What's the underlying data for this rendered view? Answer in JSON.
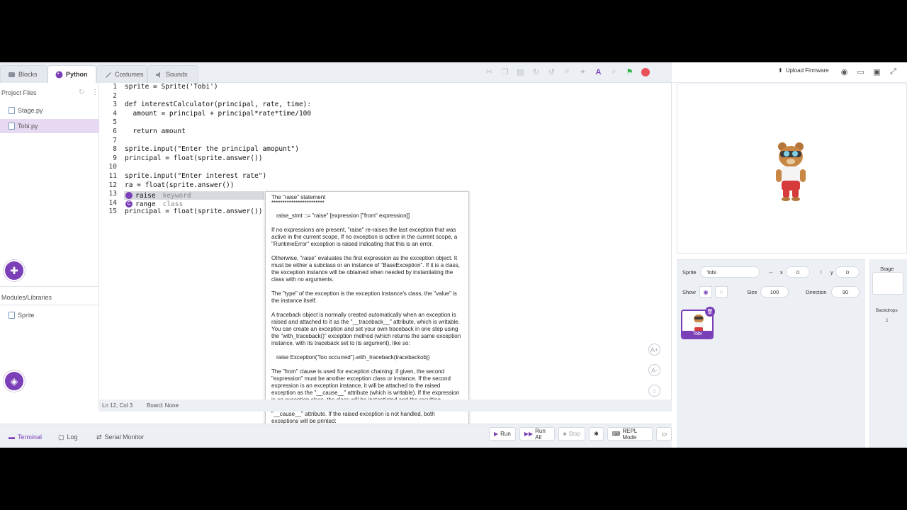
{
  "tabs": [
    {
      "label": "Blocks",
      "icon": "blocks-icon"
    },
    {
      "label": "Python",
      "icon": "python-icon"
    },
    {
      "label": "Costumes",
      "icon": "costumes-icon"
    },
    {
      "label": "Sounds",
      "icon": "sounds-icon"
    }
  ],
  "upload_firmware": "Upload Firmware",
  "sidebar": {
    "project_files_title": "Project Files",
    "files": [
      "Stage.py",
      "Tobi.py"
    ],
    "modules_title": "Modules/Libraries",
    "modules": [
      "Sprite"
    ]
  },
  "code_lines": [
    "sprite = Sprite('Tobi')",
    "",
    "def interestCalculator(principal, rate, time):",
    "  amount = principal + principal*rate*time/100",
    "",
    "  return amount",
    "",
    "sprite.input(\"Enter the principal amopunt\")",
    "principal = float(sprite.answer())",
    "",
    "sprite.input(\"Enter interest rate\")",
    "ra = float(sprite.answer())",
    "",
    "",
    "principal = float(sprite.answer())"
  ],
  "line_numbers": [
    "1",
    "2",
    "3",
    "4",
    "5",
    "6",
    "7",
    "8",
    "9",
    "10",
    "11",
    "12",
    "13",
    "14",
    "15"
  ],
  "autocomplete": [
    {
      "name": "raise",
      "kind": "keyword",
      "badge": ""
    },
    {
      "name": "range",
      "kind": "class",
      "badge": "C"
    }
  ],
  "doc": {
    "title": "The \"raise\" statement",
    "underline": "************************",
    "paragraphs": [
      "raise_stmt ::= \"raise\" [expression [\"from\" expression]]",
      "If no expressions are present, \"raise\" re-raises the last exception that was active in the current scope.  If no exception is active in the current scope, a \"RuntimeError\" exception is raised indicating that this is an error.",
      "Otherwise, \"raise\" evaluates the first expression as the exception object.  It must be either a subclass or an instance of \"BaseException\". If it is a class, the exception instance will be obtained when needed by instantiating the class with no arguments.",
      "The \"type\" of the exception is the exception instance's class, the \"value\" is the instance itself.",
      "A traceback object is normally created automatically when an exception is raised and attached to it as the \"__traceback__\" attribute, which is writable. You can create an exception and set your own traceback in one step using the \"with_traceback()\" exception method (which returns the same exception instance, with its traceback set to its argument), like so:",
      "raise Exception(\"foo occurred\").with_traceback(tracebackobj)",
      "The \"from\" clause is used for exception chaining: if given, the second \"expression\" must be another exception class or instance. If the second expression is an exception instance, it will be attached to the raised exception as the \"__cause__\" attribute (which is writable). If the expression is an exception class, the class will be instantiated and the resulting exception instance will be attached to the raised exception as the \"__cause__\" attribute. If the raised exception is not handled, both exceptions will be printed:"
    ]
  },
  "status": {
    "position": "Ln 12, Col 3",
    "board": "Board: None"
  },
  "bottom_tabs": [
    "Terminal",
    "Log",
    "Serial Monitor"
  ],
  "run_buttons": {
    "run": "Run",
    "run_all": "Run All",
    "stop": "Stop",
    "repl": "REPL Mode"
  },
  "sprite": {
    "label": "Sprite",
    "name": "Tobi",
    "x_label": "x",
    "x": "0",
    "y_label": "y",
    "y": "0",
    "show_label": "Show",
    "size_label": "Size",
    "size": "100",
    "direction_label": "Direction",
    "direction": "90",
    "card_name": "Tobi"
  },
  "stage_panel": {
    "title": "Stage",
    "backdrops_label": "Backdrops",
    "backdrops_count": "1"
  },
  "colors": {
    "accent": "#7b3fb8",
    "green_flag": "#34b24a",
    "stop": "#e8525a"
  }
}
